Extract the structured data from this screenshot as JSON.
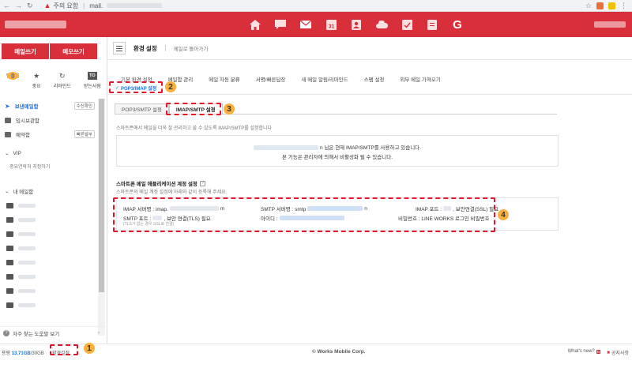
{
  "browser": {
    "warning_text": "주의 요함",
    "url_text": "mail."
  },
  "app": {
    "header_icons": [
      "home-icon",
      "chat-icon",
      "mail-icon",
      "calendar-icon",
      "contacts-icon",
      "cloud-icon",
      "task-icon",
      "form-icon",
      "google-icon"
    ],
    "google_label": "G",
    "calendar_label": "31",
    "accent_color": "#d92f3a"
  },
  "sidebar": {
    "write_mail": "메일쓰기",
    "write_memo": "메모쓰기",
    "quick": [
      {
        "value": "0",
        "label": "안읽음"
      },
      {
        "icon": "★",
        "label": "중요"
      },
      {
        "icon": "↻",
        "label": "리마인드"
      },
      {
        "badge": "TO",
        "label": "받는사람"
      }
    ],
    "folders": [
      {
        "label": "보낸메일함",
        "tag": "수신확인",
        "active": true
      },
      {
        "label": "임시보관함",
        "tag": ""
      },
      {
        "label": "예약함",
        "tag": "빠른발부"
      }
    ],
    "vip_title": "VIP",
    "vip_sub": "중요연락처 지정하기",
    "my_folders_title": "내 메일함",
    "help": "자주 찾는 도움말 보기"
  },
  "footer": {
    "usage_prefix": "용량",
    "usage_value": "13.71GB",
    "usage_total": "/30GB",
    "env_settings": "환경설정",
    "copyright": "© Works Mobile Corp.",
    "whatsnew": "What's new?",
    "new_badge": "N",
    "notice": "공지사항"
  },
  "main": {
    "title": "환경 설정",
    "back_link": "메일로 돌아가기",
    "tabs": [
      "기본 환경 설정",
      "메일함 관리",
      "메일 자동 분류",
      "서명/빠른답장",
      "새 메일 알림/리마인드",
      "스팸 설정",
      "외부 메일 가져오기"
    ],
    "subtab": "POP3/IMAP 설정",
    "subtab_more": "기",
    "inner_tabs": [
      "POP3/SMTP 설정",
      "IMAP/SMTP 설정"
    ],
    "description": "스마트폰에서 메일을 더욱 잘 관리하고 쓸 수 있도록 IMAP/SMTP를 설정합니다",
    "info_line1": "n 님은 현재 IMAP/SMTP를 사용하고 있습니다.",
    "info_line2": "본 기능은 관리자에 의해서 비활성화 될 수 있습니다.",
    "section_title": "스마트폰 메일 애플리케이션 계정 설정",
    "section_desc": "스마트폰의 메일 계정 설정에 아래와 같이 등록해 주세요.",
    "imap_server_label": "IMAP 서버명 : imap.",
    "imap_server_tail": "m",
    "smtp_server_label": "SMTP 서버명 : smtp",
    "smtp_server_tail": "n",
    "imap_port_label": "IMAP 포트 :",
    "imap_port_tail": ", 보안연결(SSL) 필요",
    "smtp_port_label": "SMTP 포트 :",
    "smtp_port_tail": ", 보안 연결(TLS) 필요",
    "smtp_note": "(TLS가 없는 경우 SSL로 연결)",
    "id_label": "아이디 :",
    "password_label": "비밀번호 : LINE WORKS 로그인 비밀번호"
  },
  "annotations": {
    "n1": "1",
    "n2": "2",
    "n3": "3",
    "n4": "4"
  }
}
